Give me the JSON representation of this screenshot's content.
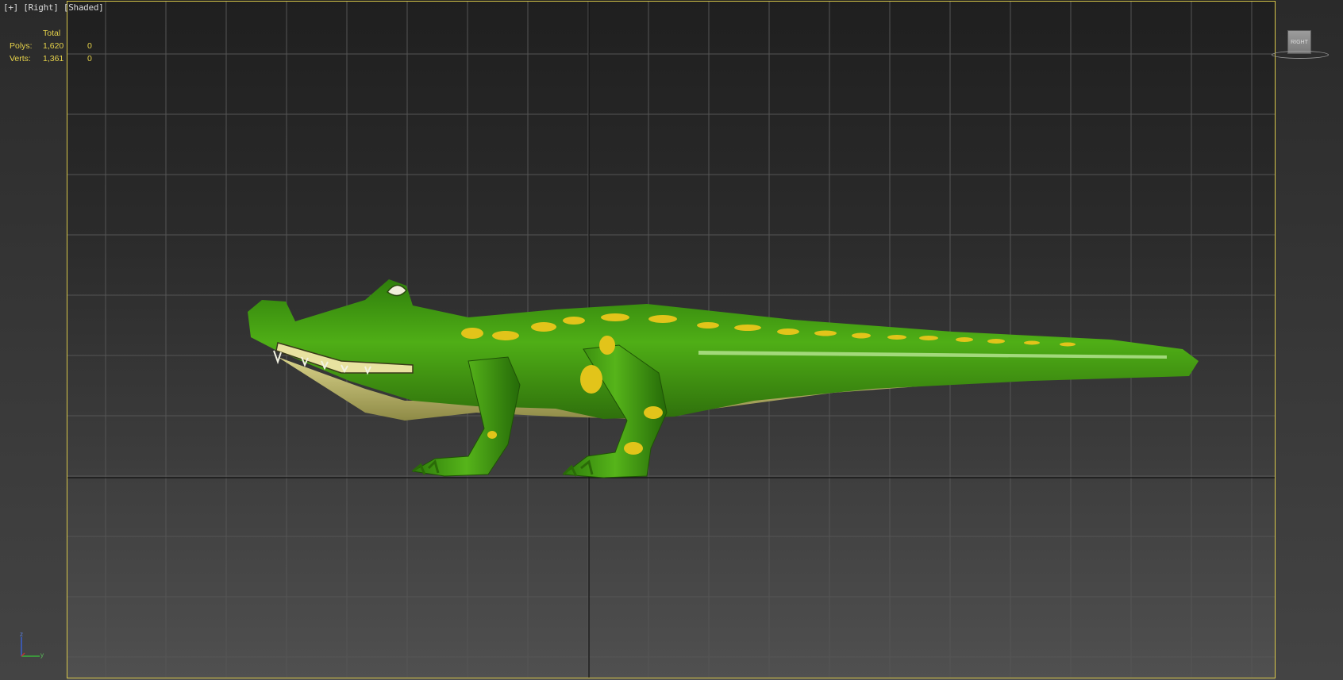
{
  "viewport": {
    "menu_plus": "[+]",
    "view_name": "[Right]",
    "shading_mode": "[Shaded]"
  },
  "stats": {
    "header": "Total",
    "polys_label": "Polys:",
    "polys_total": "1,620",
    "polys_selected": "0",
    "verts_label": "Verts:",
    "verts_total": "1,361",
    "verts_selected": "0"
  },
  "viewcube": {
    "face_label": "RIGHT"
  },
  "axis": {
    "z_label": "z",
    "y_label": "y"
  },
  "colors": {
    "frame_border": "#d9c84a",
    "stats_text": "#e6d24a",
    "grid_line": "#5a5a5a",
    "model_green": "#3f9a12",
    "model_belly": "#c8c27a",
    "model_spots": "#e2c41a"
  },
  "model": {
    "object": "crocodile-mesh"
  }
}
